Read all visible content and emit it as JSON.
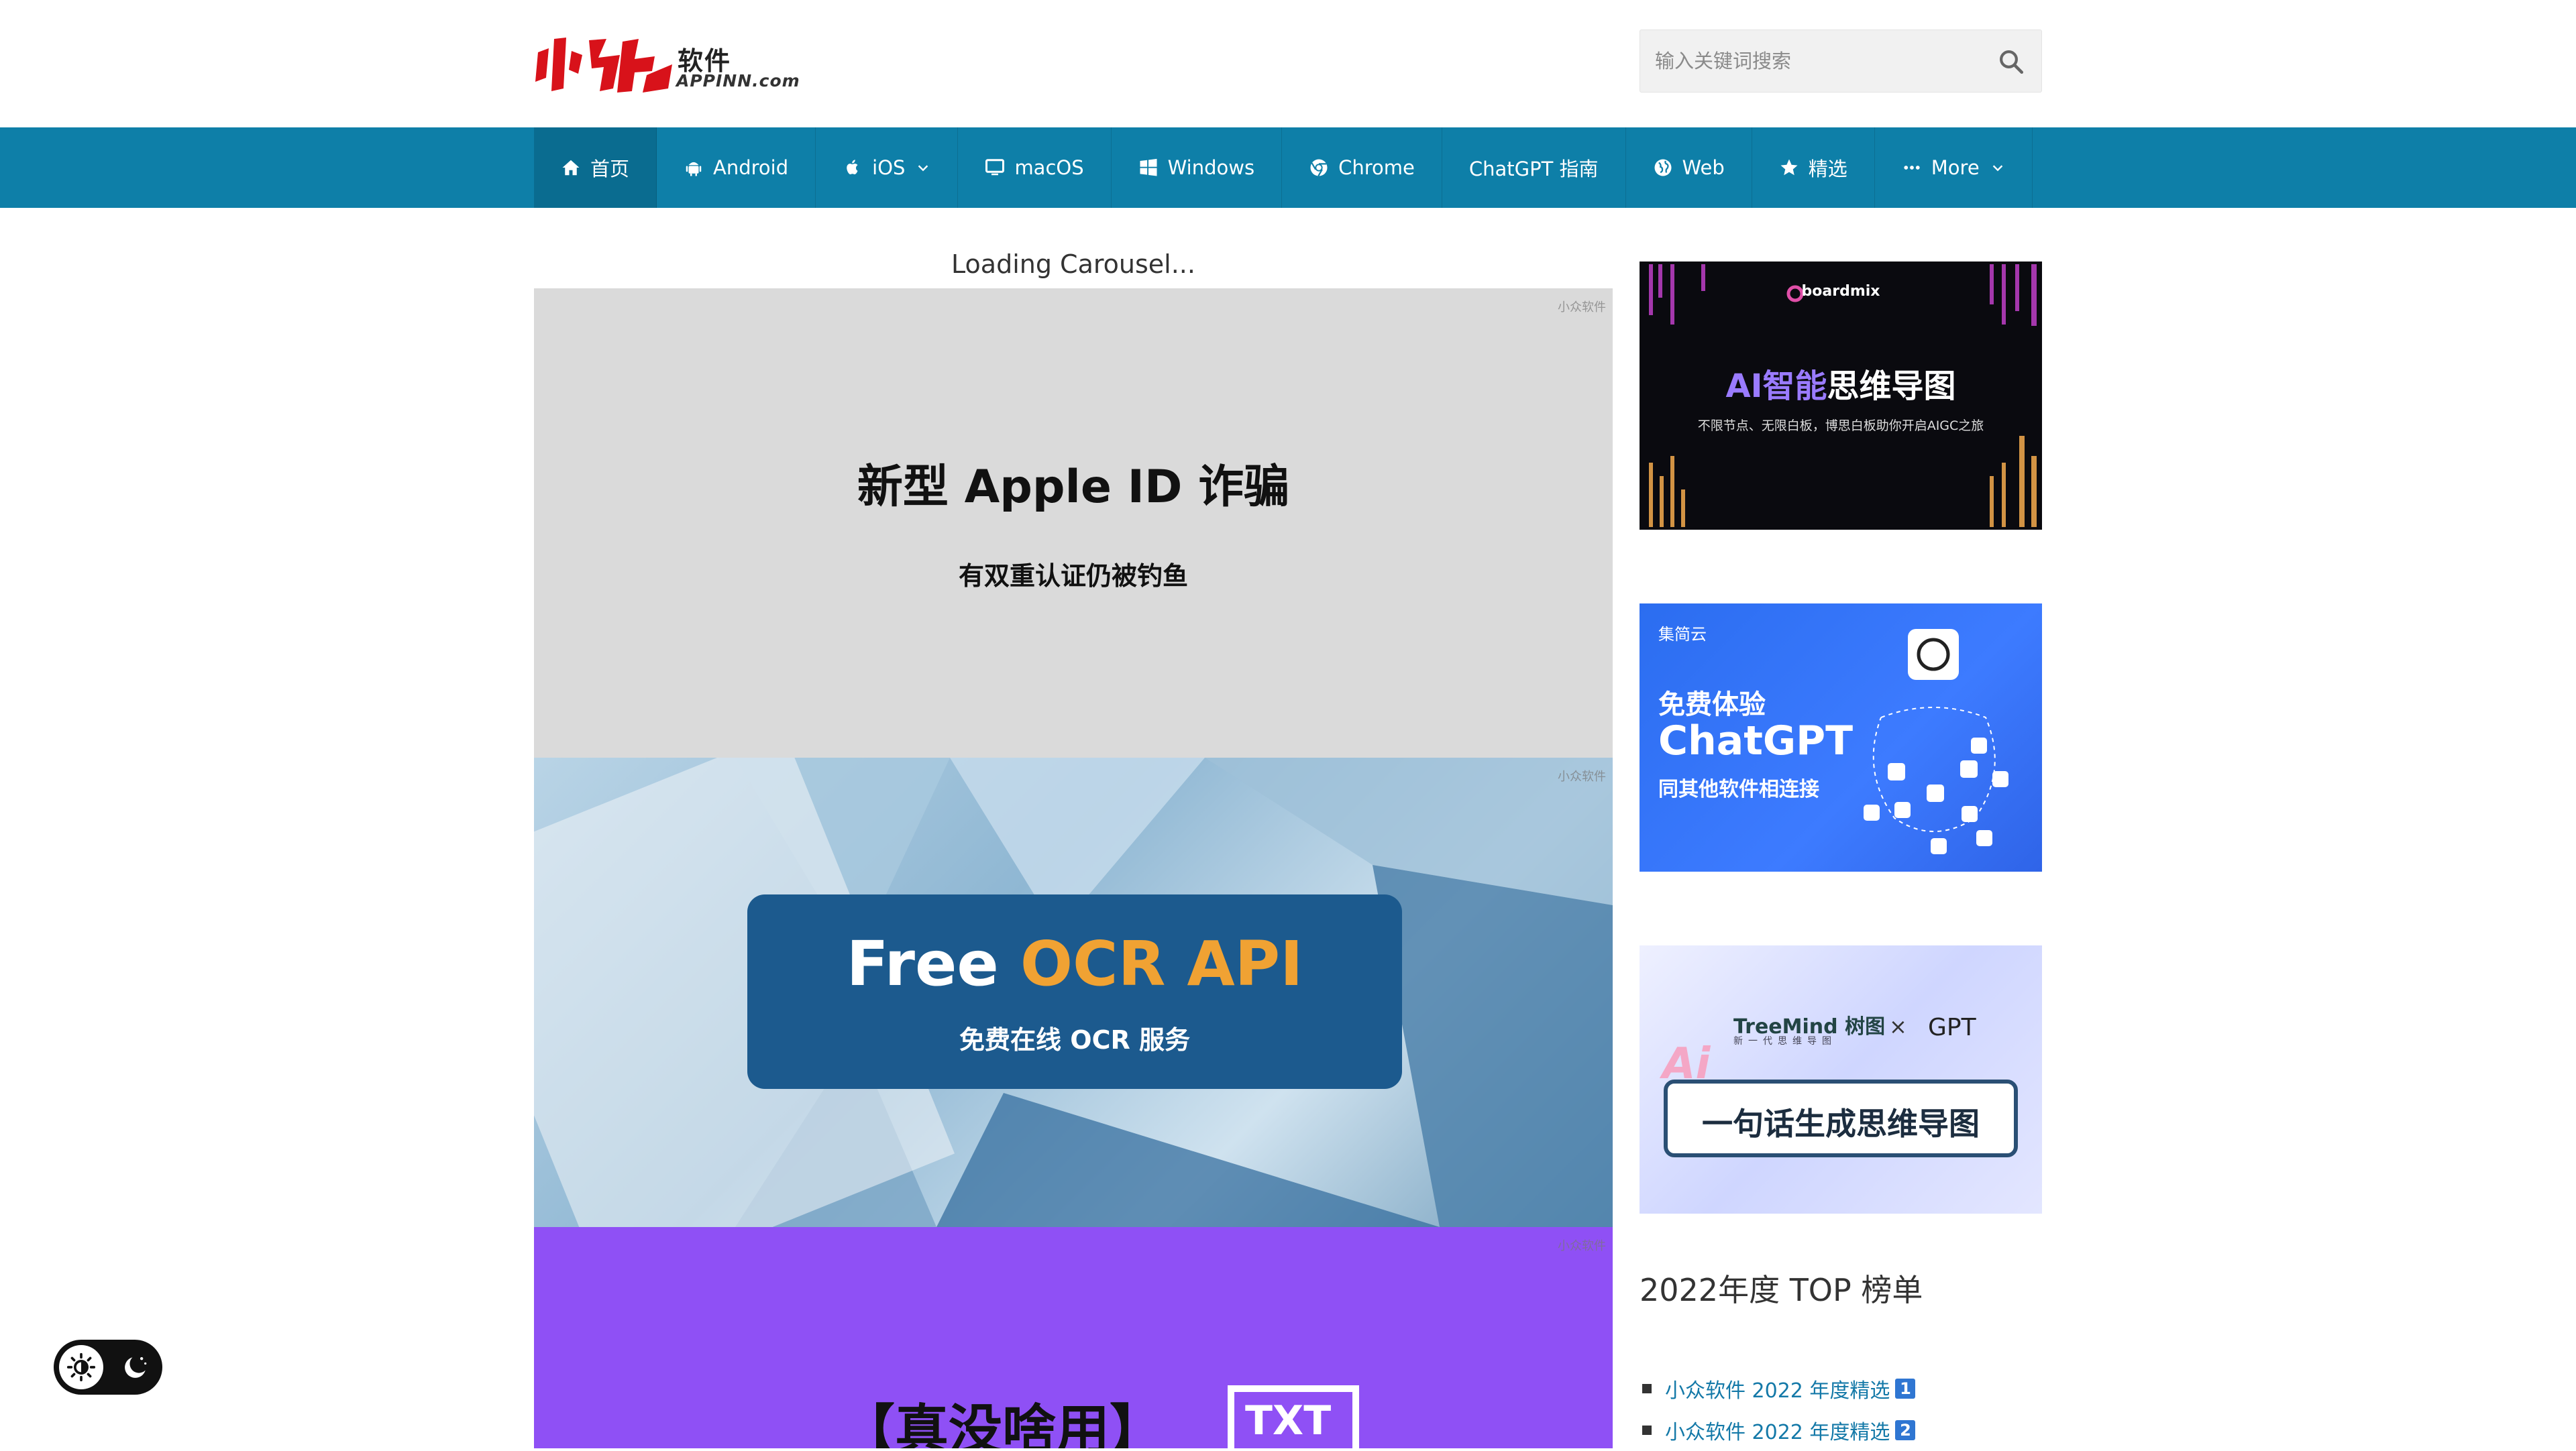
{
  "header": {
    "logo_cn": "软件",
    "logo_en": "APPINN.com",
    "search_placeholder": "输入关键词搜索"
  },
  "nav": {
    "items": [
      {
        "label": "首页",
        "icon": "home-icon",
        "active": true
      },
      {
        "label": "Android",
        "icon": "android-icon"
      },
      {
        "label": "iOS",
        "icon": "apple-icon",
        "dropdown": true
      },
      {
        "label": "macOS",
        "icon": "monitor-icon"
      },
      {
        "label": "Windows",
        "icon": "windows-icon"
      },
      {
        "label": "Chrome",
        "icon": "chrome-icon"
      },
      {
        "label": "ChatGPT 指南"
      },
      {
        "label": "Web",
        "icon": "globe-icon"
      },
      {
        "label": "精选",
        "icon": "star-icon"
      },
      {
        "label": "More",
        "icon": "more-icon",
        "dropdown": true
      }
    ],
    "background": "#0e7fa8"
  },
  "carousel": {
    "loading_text": "Loading Carousel...",
    "watermark": "小众软件",
    "slides": [
      {
        "title": "新型 Apple ID 诈骗",
        "subtitle": "有双重认证仍被钓鱼"
      },
      {
        "title_part1": "Free",
        "title_part2": "OCR API",
        "subtitle": "免费在线 OCR 服务"
      },
      {
        "title": "【真没啥用】",
        "badge": "TXT"
      }
    ]
  },
  "sidebar": {
    "ad1": {
      "brand": "boardmix",
      "title_ai": "AI智能",
      "title_rest": "思维导图",
      "subtitle": "不限节点、无限白板，博思白板助你开启AIGC之旅"
    },
    "ad2": {
      "brand": "集简云",
      "line1": "免费体验",
      "line2": "ChatGPT",
      "line3": "同其他软件相连接"
    },
    "ad3": {
      "brand": "TreeMind 树图",
      "brand_sub": "新一代思维导图",
      "x": "×",
      "gpt": "GPT",
      "ai": "Ai",
      "slogan": "一句话生成思维导图"
    },
    "heading": "2022年度 TOP 榜单",
    "list": [
      {
        "label": "小众软件 2022 年度精选",
        "badge": "1"
      },
      {
        "label": "小众软件 2022 年度精选",
        "badge": "2"
      }
    ]
  },
  "theme_toggle": {
    "light_icon": "sun-icon",
    "dark_icon": "moon-icon"
  }
}
